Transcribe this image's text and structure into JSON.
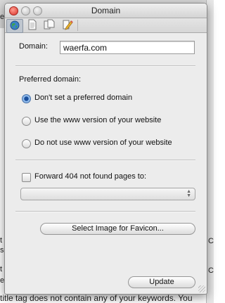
{
  "window": {
    "title": "Domain"
  },
  "toolbar": {
    "icons": [
      "globe-icon",
      "page-icon",
      "pages-icon",
      "edit-icon"
    ],
    "selected": "globe-icon"
  },
  "domain": {
    "label": "Domain:",
    "value": "waerfa.com"
  },
  "preferred": {
    "heading": "Preferred domain:",
    "options": [
      {
        "label": "Don't set a preferred domain",
        "checked": true
      },
      {
        "label": "Use the www version of your website",
        "checked": false
      },
      {
        "label": "Do not use www version of your website",
        "checked": false
      }
    ]
  },
  "forward": {
    "label": "Forward 404 not found pages to:",
    "checked": false,
    "selected": ""
  },
  "favicon_button": "Select Image for Favicon...",
  "update_button": "Update",
  "background": {
    "top_fragment": "es",
    "lines": [
      "t",
      "sh",
      "t",
      "et",
      "title tag does not contain any of your keywords. You"
    ],
    "right_fragments": [
      "C",
      "C"
    ]
  },
  "colors": {
    "accent": "#1a4f9c",
    "window": "#ececec"
  }
}
